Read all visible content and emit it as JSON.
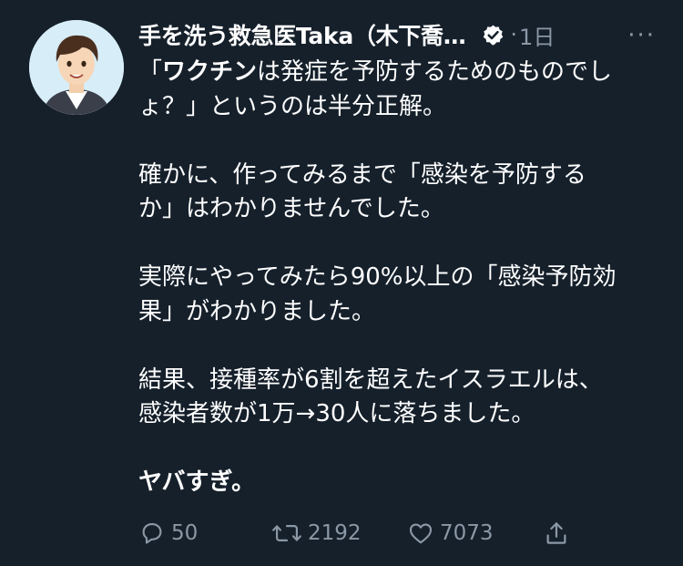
{
  "tweet": {
    "display_name": "手を洗う救急医Taka（木下喬…",
    "separator": "·",
    "timestamp": "1日",
    "more_label": "···",
    "icons": {
      "avatar": "avatar",
      "verified": "verified-badge-icon",
      "reply": "reply-icon",
      "retweet": "retweet-icon",
      "like": "like-icon",
      "share": "share-icon"
    },
    "body": {
      "p1_bold": "ワクチン",
      "p1_line1_before": "「",
      "p1_line1_after": "は発症を予防するためのものでし",
      "p1_line2": "ょ？」というのは半分正解。",
      "p2_line1": "確かに、作ってみるまで「感染を予防する",
      "p2_line2": "か」はわかりませんでした。",
      "p3_line1": "実際にやってみたら90%以上の「感染予防効",
      "p3_line2": "果」がわかりました。",
      "p4_line1": "結果、接種率が6割を超えたイスラエルは、",
      "p4_line2": "感染者数が1万→30人に落ちました。",
      "p5_bold": "ヤバすぎ。"
    },
    "counts": {
      "reply": "50",
      "retweet": "2192",
      "like": "7073"
    },
    "colors": {
      "background": "#15202b",
      "text": "#ffffff",
      "muted": "#8b98a5"
    }
  }
}
